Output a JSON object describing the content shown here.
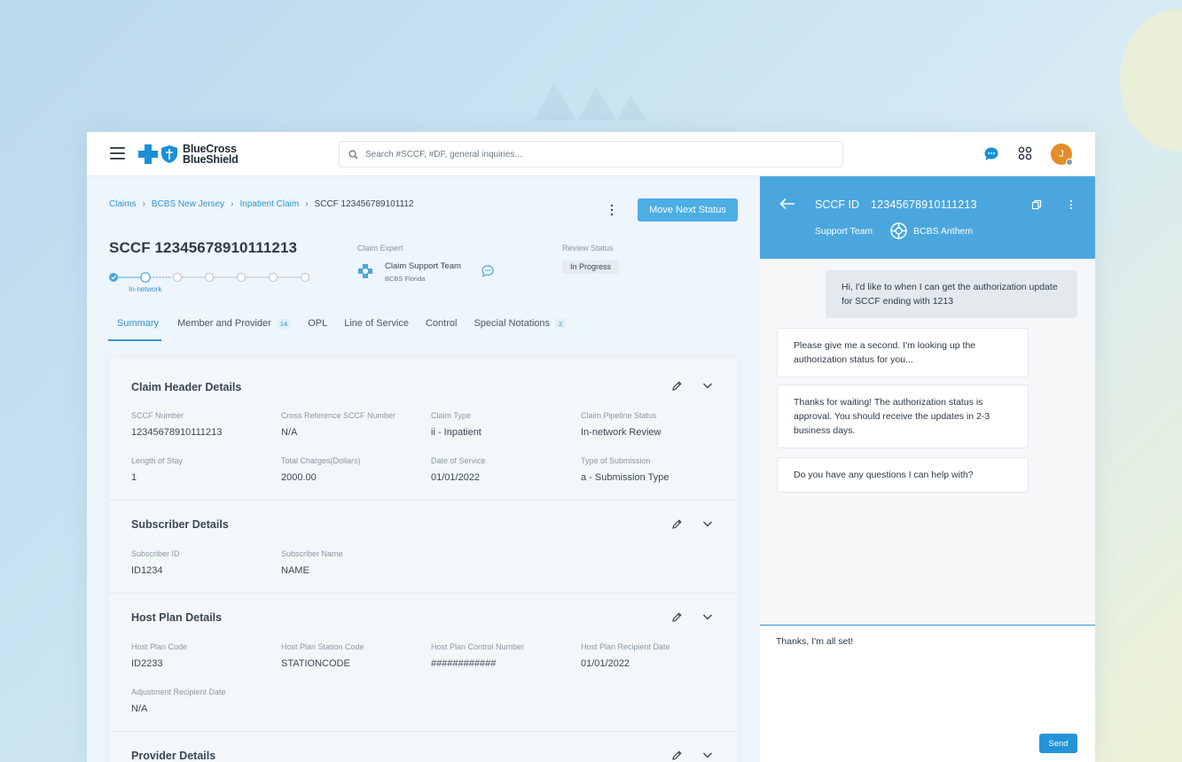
{
  "topbar": {
    "logo_line1": "BlueCross",
    "logo_line2": "BlueShield",
    "search_placeholder": "Search #SCCF, #DF, general inquiries...",
    "avatar_initial": "J"
  },
  "breadcrumb": {
    "items": [
      "Claims",
      "BCBS New Jersey",
      "Inpatient Claim"
    ],
    "current": "SCCF 123456789101112"
  },
  "actions": {
    "move_next": "Move Next Status"
  },
  "claim": {
    "title": "SCCF 12345678910111213",
    "step_label": "In-network",
    "expert_label": "Claim Expert",
    "expert_name": "Claim Support Team",
    "expert_org": "BCBS Florida",
    "review_label": "Review Status",
    "review_value": "In Progress"
  },
  "tabs": [
    {
      "label": "Summary",
      "badge": ""
    },
    {
      "label": "Member and Provider",
      "badge": "14"
    },
    {
      "label": "OPL",
      "badge": ""
    },
    {
      "label": "Line of Service",
      "badge": ""
    },
    {
      "label": "Control",
      "badge": ""
    },
    {
      "label": "Special Notations",
      "badge": "2"
    }
  ],
  "sections": {
    "claim_header": {
      "title": "Claim Header Details",
      "fields": [
        {
          "label": "SCCF Number",
          "value": "12345678910111213"
        },
        {
          "label": "Cross Reference SCCF Number",
          "value": "N/A"
        },
        {
          "label": "Claim Type",
          "value": "ii - Inpatient"
        },
        {
          "label": "Claim Pipeline Status",
          "value": "In-network Review"
        },
        {
          "label": "Length of Stay",
          "value": "1"
        },
        {
          "label": "Total Charges(Dollars)",
          "value": "2000.00"
        },
        {
          "label": "Date of Service",
          "value": "01/01/2022"
        },
        {
          "label": "Type of Submission",
          "value": "a - Submission Type"
        }
      ]
    },
    "subscriber": {
      "title": "Subscriber Details",
      "fields": [
        {
          "label": "Subscriber ID",
          "value": "ID1234"
        },
        {
          "label": "Subscriber Name",
          "value": "NAME"
        }
      ]
    },
    "host_plan": {
      "title": "Host Plan Details",
      "fields": [
        {
          "label": "Host Plan Code",
          "value": "ID2233"
        },
        {
          "label": "Host Plan Station Code",
          "value": "STATIONCODE"
        },
        {
          "label": "Host Plan Control Number",
          "value": "############"
        },
        {
          "label": "Host Plan Recipient Date",
          "value": "01/01/2022"
        },
        {
          "label": "Adjustment Recipient Date",
          "value": "N/A"
        }
      ]
    },
    "provider": {
      "title": "Provider Details"
    }
  },
  "chat": {
    "id_label": "SCCF ID",
    "id_value": "12345678910111213",
    "team_label": "Support Team",
    "org_label": "BCBS Anthem",
    "messages": [
      {
        "from": "user",
        "text": "Hi, I'd like to when I can get the authorization update for SCCF ending with 1213"
      },
      {
        "from": "agent",
        "text": "Please give me a second. I'm looking up the authorization status for you..."
      },
      {
        "from": "agent",
        "text": "Thanks for waiting! The authorization status is approval. You should receive the updates in 2-3 business days."
      },
      {
        "from": "agent",
        "text": "Do you have any questions I can help with?"
      }
    ],
    "composer_value": "Thanks, I'm all set!",
    "send_label": "Send"
  },
  "colors": {
    "accent": "#2f95cf",
    "chat_header": "#4ba6de",
    "button": "#4baee4",
    "avatar": "#e58c2a"
  }
}
